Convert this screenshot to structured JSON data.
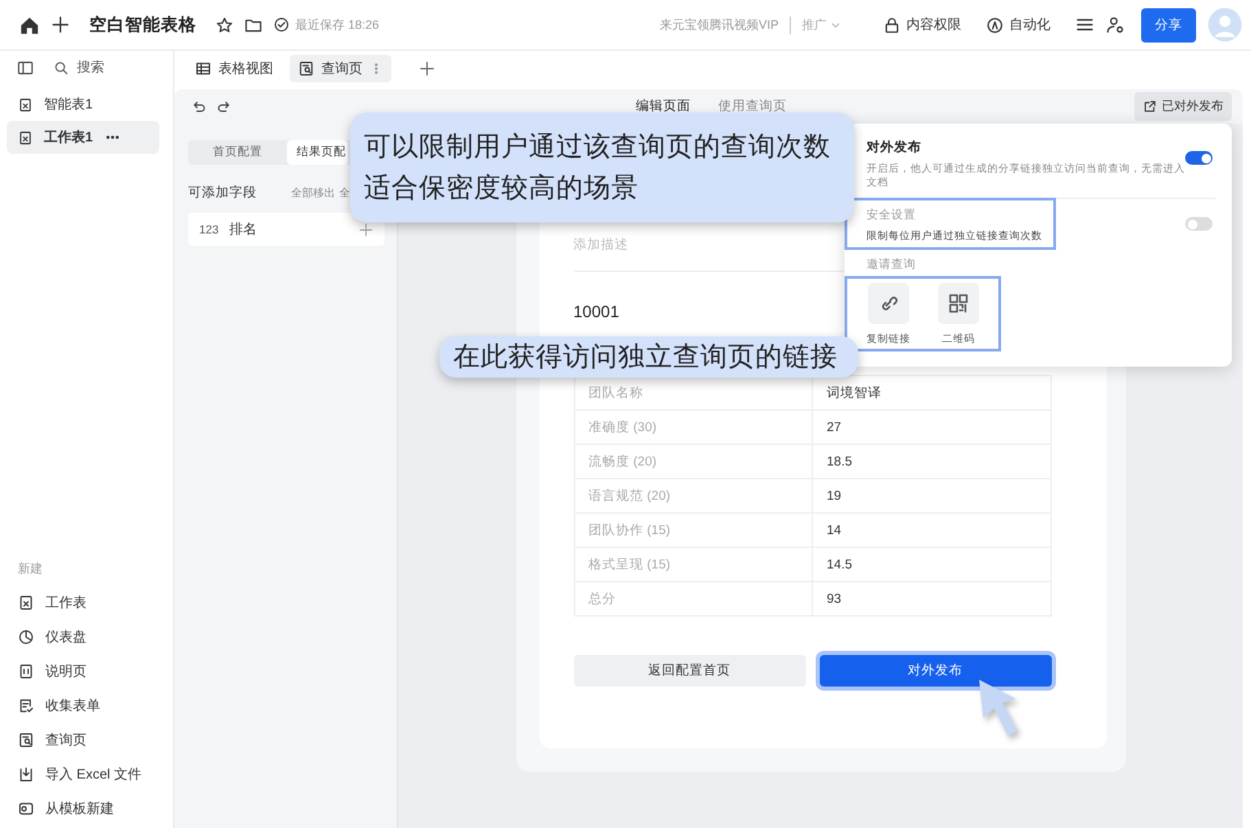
{
  "topbar": {
    "title": "空白智能表格",
    "save_status": "最近保存 18:26",
    "promo": "来元宝领腾讯视频VIP",
    "promo_menu": "推广",
    "actions": [
      {
        "label": "内容权限",
        "kind": "permissions"
      },
      {
        "label": "自动化",
        "kind": "automation"
      }
    ],
    "share_button": "分享"
  },
  "search": {
    "placeholder": "搜索"
  },
  "view_tabs": [
    {
      "label": "表格视图",
      "kind": "table",
      "selected": false
    },
    {
      "label": "查询页",
      "kind": "query",
      "selected": true
    }
  ],
  "sidebar": {
    "items": [
      {
        "label": "智能表1",
        "selected": false
      },
      {
        "label": "工作表1",
        "selected": true
      }
    ],
    "new_title": "新建",
    "new_items": [
      {
        "label": "工作表",
        "kind": "sheet"
      },
      {
        "label": "仪表盘",
        "kind": "dashboard"
      },
      {
        "label": "说明页",
        "kind": "doc"
      },
      {
        "label": "收集表单",
        "kind": "form"
      },
      {
        "label": "查询页",
        "kind": "query"
      },
      {
        "label": "导入 Excel 文件",
        "kind": "import"
      },
      {
        "label": "从模板新建",
        "kind": "template"
      }
    ]
  },
  "editor": {
    "mode_tabs": [
      {
        "label": "编辑页面",
        "selected": true
      },
      {
        "label": "使用查询页",
        "selected": false
      }
    ],
    "published_button": "已对外发布",
    "config_tabs": [
      {
        "label": "首页配置",
        "selected": false
      },
      {
        "label": "结果页配",
        "selected": true
      }
    ],
    "fields_title": "可添加字段",
    "fields_actions": [
      "全部移出",
      "全"
    ],
    "fields": [
      {
        "type": "123",
        "label": "排名"
      }
    ],
    "card": {
      "description_placeholder": "添加描述",
      "query_value": "10001",
      "rows": [
        {
          "label": "团队名称",
          "value": "词境智译"
        },
        {
          "label": "准确度 (30)",
          "value": "27"
        },
        {
          "label": "流畅度 (20)",
          "value": "18.5"
        },
        {
          "label": "语言规范 (20)",
          "value": "19"
        },
        {
          "label": "团队协作 (15)",
          "value": "14"
        },
        {
          "label": "格式呈现 (15)",
          "value": "14.5"
        },
        {
          "label": "总分",
          "value": "93"
        }
      ],
      "buttons": [
        {
          "label": "返回配置首页",
          "kind": "secondary",
          "highlighted": false
        },
        {
          "label": "对外发布",
          "kind": "primary",
          "highlighted": true
        }
      ]
    }
  },
  "publish_popover": {
    "title": "对外发布",
    "description": "开启后，他人可通过生成的分享链接独立访问当前查询，无需进入文档",
    "on": true,
    "security": {
      "title": "安全设置",
      "description": "限制每位用户通过独立链接查询次数",
      "on": false,
      "highlighted": true
    },
    "invite": {
      "title": "邀请查询",
      "highlighted": true,
      "options": [
        {
          "label": "复制链接",
          "kind": "link"
        },
        {
          "label": "二维码",
          "kind": "qrcode"
        }
      ]
    }
  },
  "callouts": [
    {
      "lines": [
        "可以限制用户通过该查询页的查询次数",
        "适合保密度较高的场景"
      ]
    },
    {
      "lines": [
        "在此获得访问独立查询页的链接"
      ]
    }
  ]
}
